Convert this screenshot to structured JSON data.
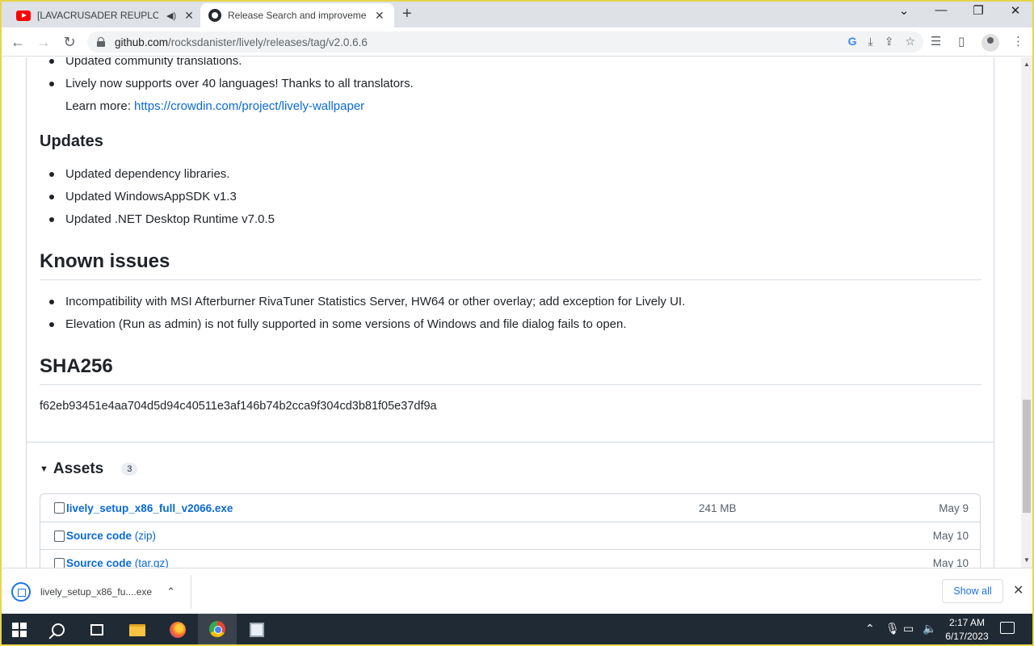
{
  "browser": {
    "tabs": [
      {
        "title": "[LAVACRUSADER REUPLOAD",
        "icon": "youtube-icon",
        "audio": true
      },
      {
        "title": "Release Search and improvement",
        "icon": "github-icon",
        "active": true
      }
    ],
    "url_host": "github.com",
    "url_path": "/rocksdanister/lively/releases/tag/v2.0.6.6"
  },
  "release": {
    "bullets_top": [
      "Updated community translations.",
      "Lively now supports over 40 languages! Thanks to all translators."
    ],
    "learn_more_label": "Learn more:",
    "learn_more_link": "https://crowdin.com/project/lively-wallpaper",
    "updates_heading": "Updates",
    "updates": [
      "Updated dependency libraries.",
      "Updated WindowsAppSDK v1.3",
      "Updated .NET Desktop Runtime v7.0.5"
    ],
    "known_issues_heading": "Known issues",
    "known_issues": [
      "Incompatibility with MSI Afterburner RivaTuner Statistics Server, HW64 or other overlay; add exception for Lively UI.",
      "Elevation (Run as admin) is not fully supported in some versions of Windows and file dialog fails to open."
    ],
    "sha_heading": "SHA256",
    "sha_value": "f62eb93451e4aa704d5d94c40511e3af146b74b2cca9f304cd3b81f05e37df9a"
  },
  "assets": {
    "title": "Assets",
    "count": "3",
    "rows": [
      {
        "name": "lively_setup_x86_full_v2066.exe",
        "ext": "",
        "size": "241 MB",
        "date": "May 9"
      },
      {
        "name": "Source code",
        "ext": "(zip)",
        "size": "",
        "date": "May 10"
      },
      {
        "name": "Source code",
        "ext": "(tar.gz)",
        "size": "",
        "date": "May 10"
      }
    ]
  },
  "downloads": {
    "file": "lively_setup_x86_fu....exe",
    "show_all": "Show all"
  },
  "taskbar": {
    "time": "2:17 AM",
    "date": "6/17/2023"
  }
}
